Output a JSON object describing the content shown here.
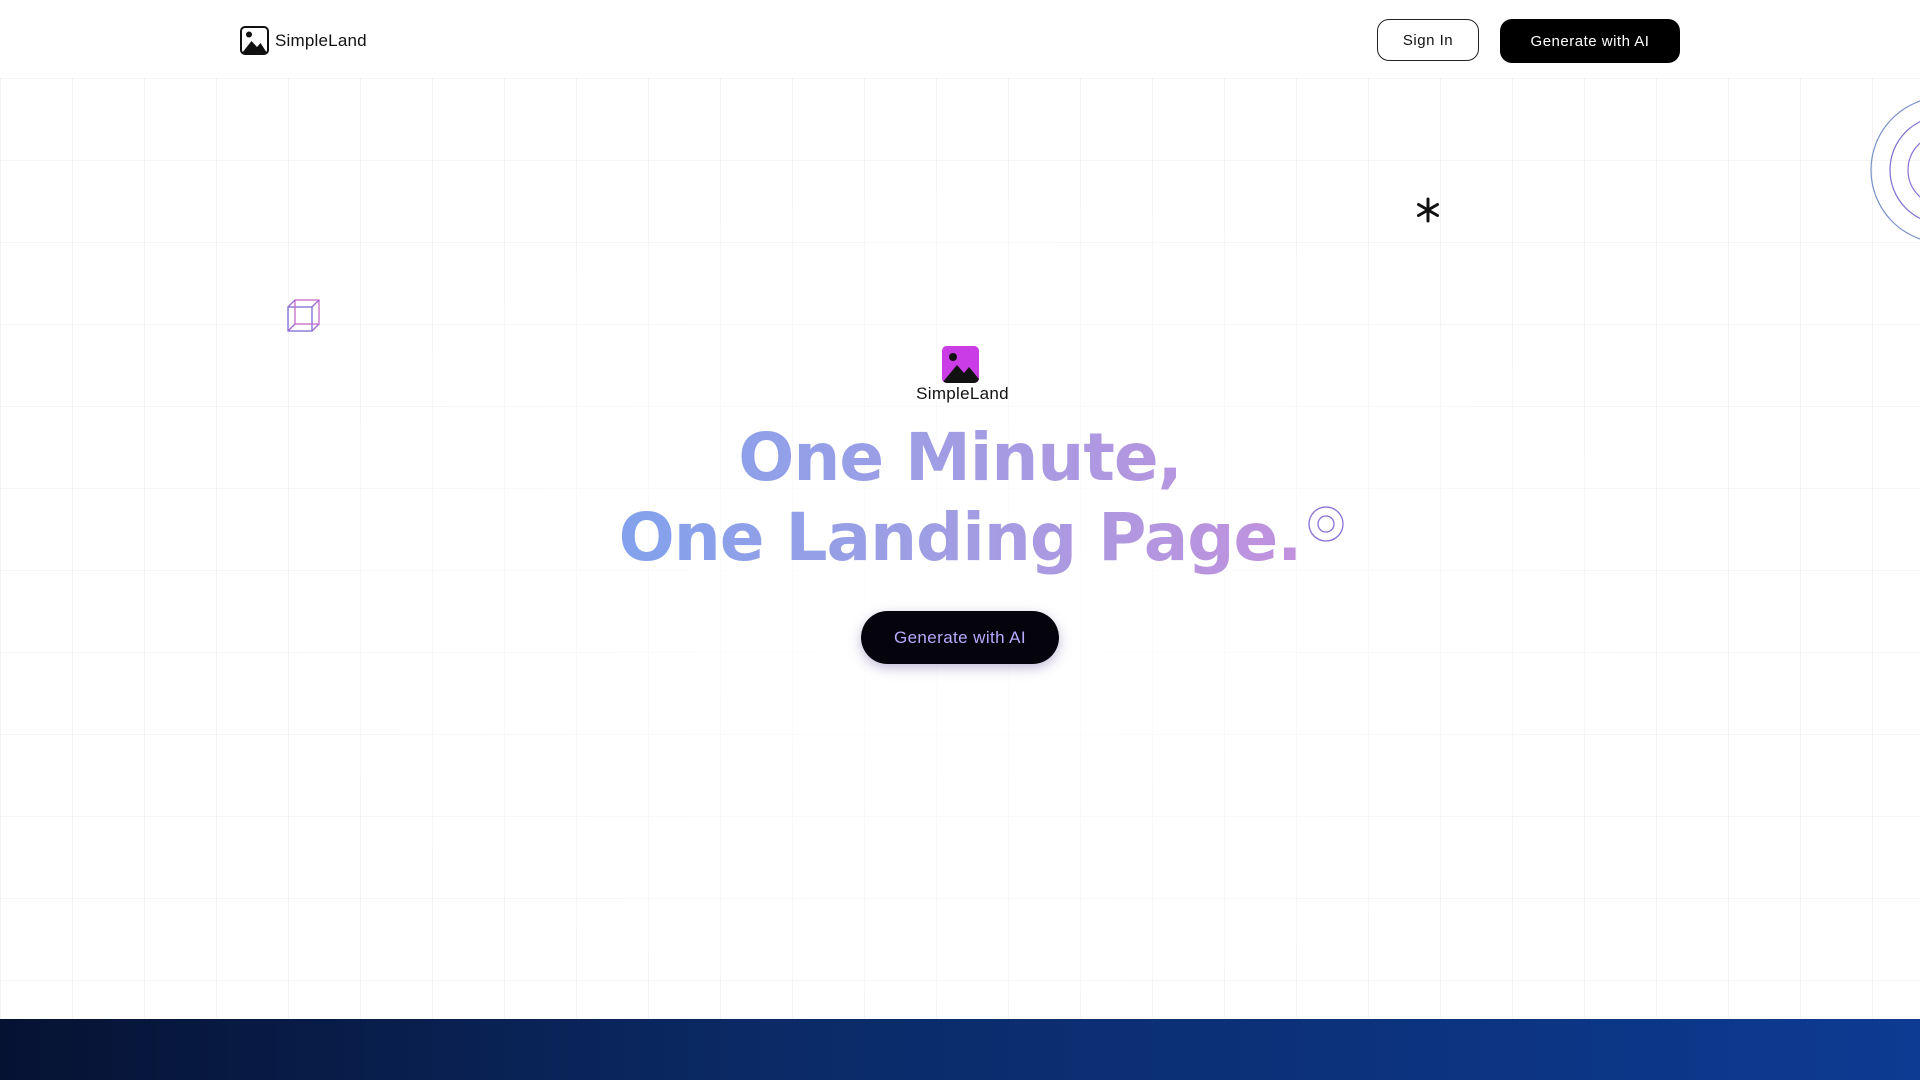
{
  "header": {
    "brand_name": "SimpleLand",
    "sign_in_label": "Sign In",
    "generate_label": "Generate with AI"
  },
  "hero": {
    "logo_name": "SimpleLand",
    "headline_line1": "One Minute,",
    "headline_line2": "One Landing Page.",
    "cta_label": "Generate with AI"
  },
  "icons": {
    "brand": "image-icon",
    "hero_logo": "image-icon",
    "cube": "cube-icon",
    "asterisk": "asterisk-icon",
    "ring": "concentric-circle-icon",
    "corner_rings": "concentric-circles-decoration"
  },
  "colors": {
    "headline_gradient_start": "#7da2ee",
    "headline_gradient_end": "#c78fdc",
    "hero_logo_bg": "#c93ce6",
    "primary_button": "#000000",
    "hero_cta_text": "#b9a9ff",
    "footer_start": "#061232",
    "footer_end": "#0d3a92"
  }
}
